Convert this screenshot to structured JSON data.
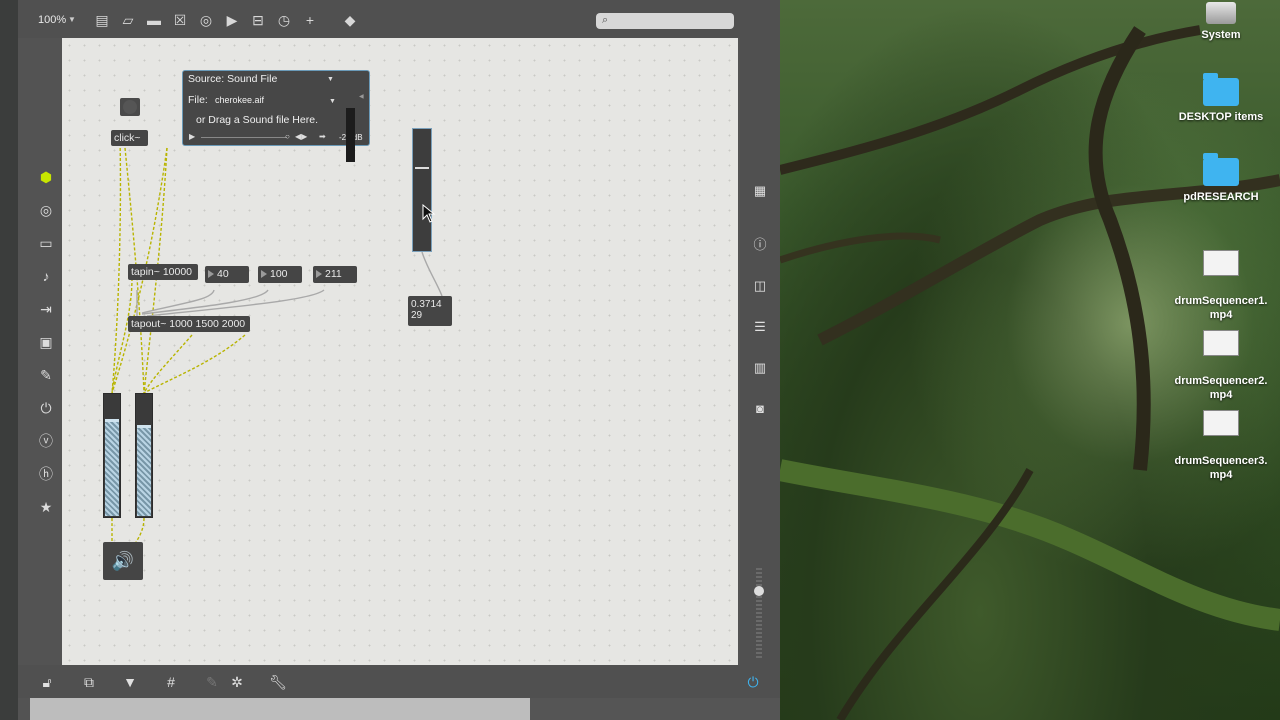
{
  "window": {
    "zoom": "100%",
    "search_placeholder": ""
  },
  "patch": {
    "button_label": "",
    "click_label": "click~",
    "playlist": {
      "source": "Source: Sound File",
      "file_label": "File:",
      "file_name": "cherokee.aif",
      "drag_hint": "or Drag a Sound file Here.",
      "gain": "-20 dB"
    },
    "tapin": "tapin~ 10000",
    "tapout": "tapout~ 1000 1500 2000",
    "num1": "40",
    "num2": "100",
    "num3": "211",
    "flonum_line1": "0.3714",
    "flonum_line2": "29",
    "gain_left_level": 0.77,
    "gain_right_level": 0.72,
    "slider_level": 0.68
  },
  "desktop": {
    "items": [
      {
        "label": "System",
        "icon": "disk-icon"
      },
      {
        "label": "DESKTOP items",
        "icon": "folder-icon"
      },
      {
        "label": "pdRESEARCH",
        "icon": "folder-icon"
      },
      {
        "label": "drumSequencer1.\nmp4",
        "icon": "video-thumb-icon"
      },
      {
        "label": "drumSequencer2.\nmp4",
        "icon": "video-thumb-icon"
      },
      {
        "label": "drumSequencer3.\nmp4",
        "icon": "video-thumb-icon"
      }
    ]
  },
  "colors": {
    "window": "#535353",
    "canvas": "#e6e6e3",
    "object": "#454545",
    "accent": "#3fb4f0",
    "cube": "#c8e600"
  }
}
